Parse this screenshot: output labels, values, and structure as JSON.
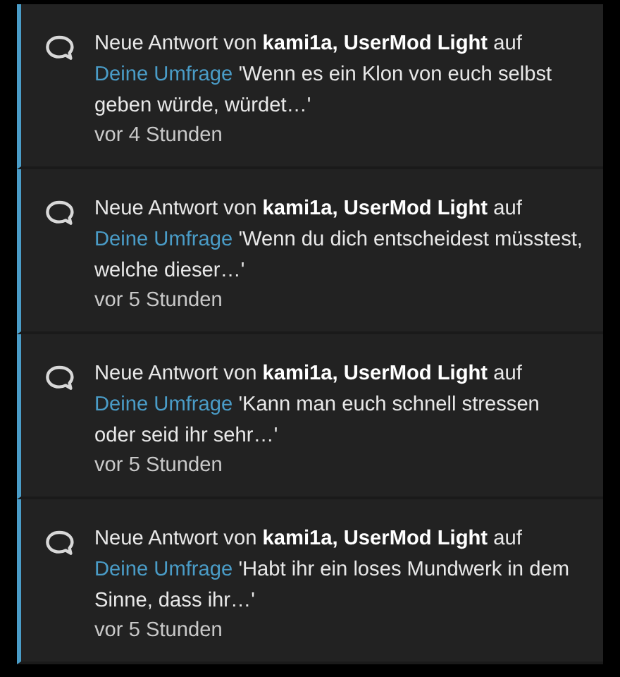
{
  "notifications": [
    {
      "unread": true,
      "text": "Neue Antwort von **kami1a, UserMod Light** auf",
      "link": "Deine Umfrage",
      "excerpt": "'Wenn es ein Klon von euch selbst geben würde, würdet…'",
      "time": "vor 4 Stunden"
    },
    {
      "unread": true,
      "text": "Neue Antwort von **kami1a, UserMod Light** auf",
      "link": "Deine Umfrage",
      "excerpt": "'Wenn du dich entscheidest müsstest, welche dieser…'",
      "time": "vor 5 Stunden"
    },
    {
      "unread": true,
      "text": "Neue Antwort von **kami1a, UserMod Light** auf",
      "link": "Deine Umfrage",
      "excerpt": "'Kann man euch schnell stressen oder seid ihr sehr…'",
      "time": "vor 5 Stunden"
    },
    {
      "unread": true,
      "text": "Neue Antwort von **kami1a, UserMod Light** auf",
      "link": "Deine Umfrage",
      "excerpt": "'Habt ihr ein loses Mundwerk in dem Sinne, dass ihr…'",
      "time": "vor 5 Stunden"
    }
  ]
}
